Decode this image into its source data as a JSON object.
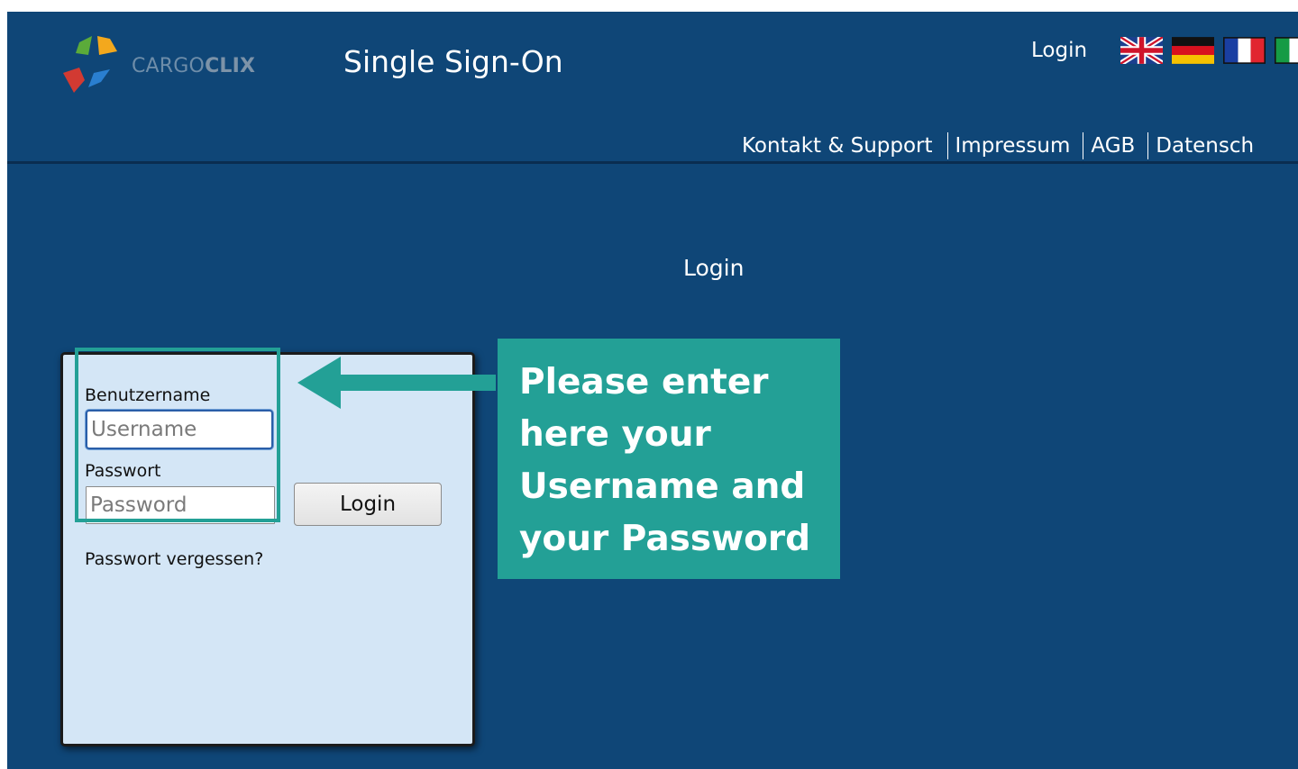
{
  "header": {
    "logo_brand_light": "CARGO",
    "logo_brand_bold": "CLIX",
    "app_title": "Single Sign-On",
    "login_link": "Login",
    "languages": [
      {
        "code": "en",
        "icon": "uk-flag-icon"
      },
      {
        "code": "de",
        "icon": "germany-flag-icon"
      },
      {
        "code": "fr",
        "icon": "france-flag-icon"
      },
      {
        "code": "it",
        "icon": "italy-flag-icon"
      }
    ]
  },
  "nav": {
    "items": [
      "Kontakt & Support",
      "Impressum",
      "AGB",
      "Datensch"
    ]
  },
  "main": {
    "title": "Login"
  },
  "login_form": {
    "username_label": "Benutzername",
    "username_placeholder": "Username",
    "password_label": "Passwort",
    "password_placeholder": "Password",
    "submit_label": "Login",
    "forgot_link": "Passwort vergessen?"
  },
  "annotation": {
    "callout_lines": [
      "Please enter",
      "here your",
      "Username and",
      "your Password"
    ]
  },
  "colors": {
    "page_background": "#0f4677",
    "panel_background": "#d4e6f6",
    "annotation_teal": "#23a096"
  }
}
